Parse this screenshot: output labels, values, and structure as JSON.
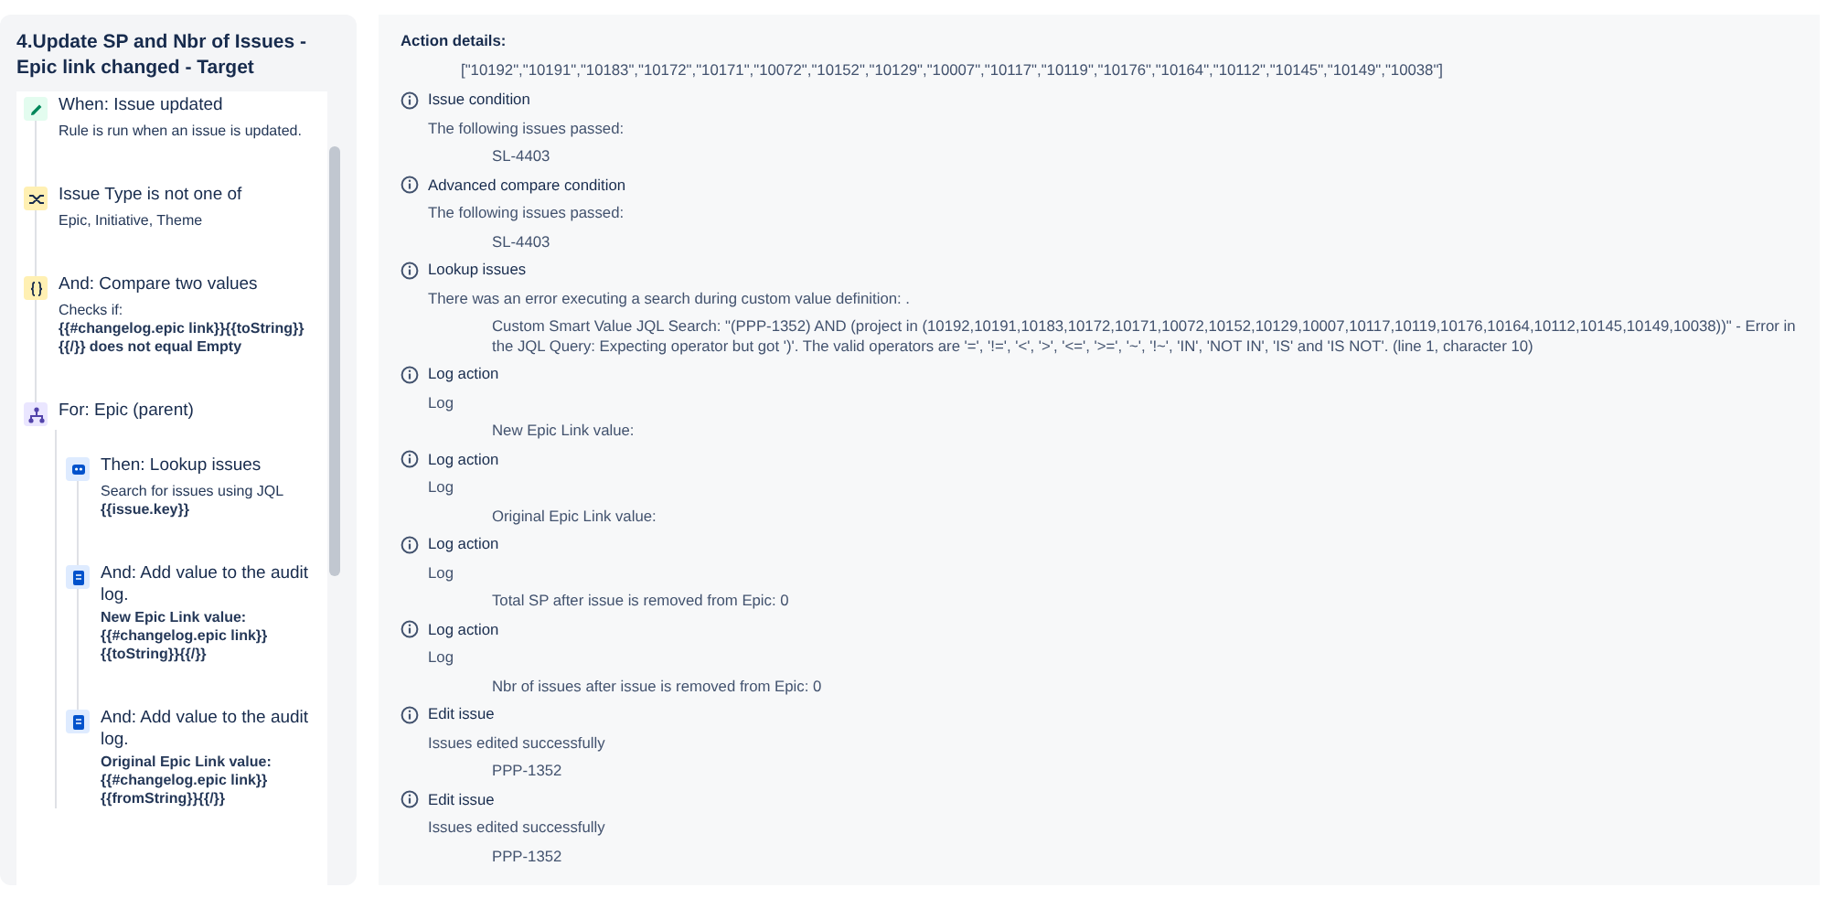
{
  "rule": {
    "title": "4.Update SP and Nbr of Issues - Epic link changed - Target",
    "steps": [
      {
        "kind": "trigger",
        "title": "When: Issue updated",
        "description": "Rule is run when an issue is updated."
      },
      {
        "kind": "condition",
        "title": "Issue Type is not one of",
        "description": "Epic, Initiative, Theme"
      },
      {
        "kind": "compare",
        "title": "And: Compare two values",
        "description": "Checks if:",
        "detail": "{{#changelog.epic link}}{{toString}}{{/}} does not equal Empty"
      },
      {
        "kind": "branch",
        "title": "For: Epic (parent)",
        "children": [
          {
            "kind": "lookup",
            "title": "Then: Lookup issues",
            "description": "Search for issues using JQL",
            "detail": "{{issue.key}}"
          },
          {
            "kind": "log",
            "title": "And: Add value to the audit log.",
            "detail": "New Epic Link value: {{#changelog.epic link}}{{toString}}{{/}}"
          },
          {
            "kind": "log",
            "title": "And: Add value to the audit log.",
            "detail": "Original Epic Link value: {{#changelog.epic link}}{{fromString}}{{/}}"
          }
        ]
      }
    ]
  },
  "details": {
    "heading": "Action details:",
    "value": "[\"10192\",\"10191\",\"10183\",\"10172\",\"10171\",\"10072\",\"10152\",\"10129\",\"10007\",\"10117\",\"10119\",\"10176\",\"10164\",\"10112\",\"10145\",\"10149\",\"10038\"]",
    "entries": [
      {
        "title": "Issue condition",
        "message": "The following issues passed:",
        "items": [
          "SL-4403"
        ]
      },
      {
        "title": "Advanced compare condition",
        "message": "The following issues passed:",
        "items": [
          "SL-4403"
        ]
      },
      {
        "title": "Lookup issues",
        "message": "There was an error executing a search during custom value definition: .",
        "items": [
          "Custom Smart Value JQL Search: \"(PPP-1352) AND (project in (10192,10191,10183,10172,10171,10072,10152,10129,10007,10117,10119,10176,10164,10112,10145,10149,10038))\" - Error in the JQL Query: Expecting operator but got ')'. The valid operators are '=', '!=', '<', '>', '<=', '>=', '~', '!~', 'IN', 'NOT IN', 'IS' and 'IS NOT'. (line 1, character 10)"
        ]
      },
      {
        "title": "Log action",
        "message": "Log",
        "items": [
          "New Epic Link value:"
        ]
      },
      {
        "title": "Log action",
        "message": "Log",
        "items": [
          "Original Epic Link value:"
        ]
      },
      {
        "title": "Log action",
        "message": "Log",
        "items": [
          "Total SP after issue is removed from Epic: 0"
        ]
      },
      {
        "title": "Log action",
        "message": "Log",
        "items": [
          "Nbr of issues after issue is removed from Epic: 0"
        ]
      },
      {
        "title": "Edit issue",
        "message": "Issues edited successfully",
        "items": [
          "PPP-1352"
        ]
      },
      {
        "title": "Edit issue",
        "message": "Issues edited successfully",
        "items": [
          "PPP-1352"
        ]
      }
    ]
  }
}
